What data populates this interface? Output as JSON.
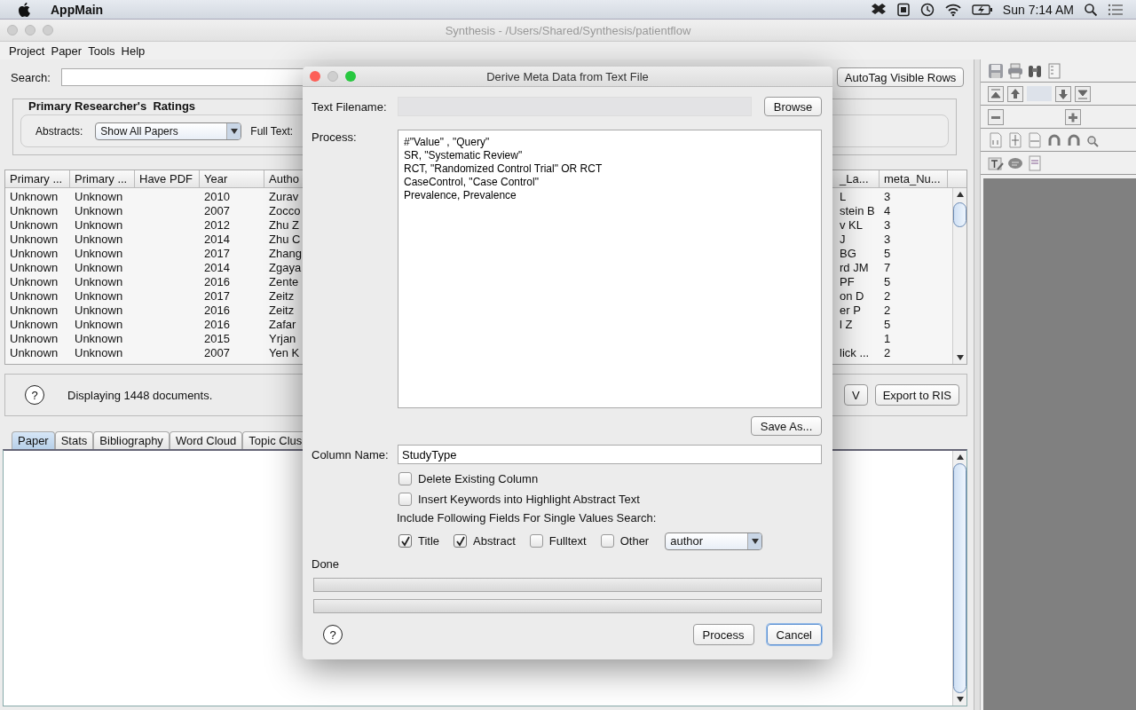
{
  "menubar": {
    "app_name": "AppMain",
    "clock": "Sun 7:14 AM"
  },
  "window": {
    "title": "Synthesis - /Users/Shared/Synthesis/patientflow"
  },
  "menu": [
    "Project",
    "Paper",
    "Tools",
    "Help"
  ],
  "search": {
    "label": "Search:"
  },
  "autotag_button": "AutoTag Visible Rows",
  "ratings": {
    "title": "Primary Researcher's  Ratings",
    "abstracts_label": "Abstracts:",
    "abstracts_value": "Show All Papers",
    "fulltext_label": "Full Text:"
  },
  "table": {
    "left_columns": [
      "Primary ...",
      "Primary ...",
      "Have PDF",
      "Year",
      "Autho"
    ],
    "right_columns": [
      "_La...",
      "meta_Nu..."
    ],
    "rows": [
      {
        "primary_1": "Unknown",
        "primary_2": "Unknown",
        "year": "2010",
        "author": "Zurav",
        "column_la": "L",
        "meta_nu": "3"
      },
      {
        "primary_1": "Unknown",
        "primary_2": "Unknown",
        "year": "2007",
        "author": "Zocco",
        "column_la": "stein B",
        "meta_nu": "4"
      },
      {
        "primary_1": "Unknown",
        "primary_2": "Unknown",
        "year": "2012",
        "author": "Zhu Z",
        "column_la": "v KL",
        "meta_nu": "3"
      },
      {
        "primary_1": "Unknown",
        "primary_2": "Unknown",
        "year": "2014",
        "author": "Zhu C",
        "column_la": "J",
        "meta_nu": "3"
      },
      {
        "primary_1": "Unknown",
        "primary_2": "Unknown",
        "year": "2017",
        "author": "Zhang",
        "column_la": "BG",
        "meta_nu": "5"
      },
      {
        "primary_1": "Unknown",
        "primary_2": "Unknown",
        "year": "2014",
        "author": "Zgaya",
        "column_la": "rd JM",
        "meta_nu": "7"
      },
      {
        "primary_1": "Unknown",
        "primary_2": "Unknown",
        "year": "2016",
        "author": "Zente",
        "column_la": "PF",
        "meta_nu": "5"
      },
      {
        "primary_1": "Unknown",
        "primary_2": "Unknown",
        "year": "2017",
        "author": "Zeitz",
        "column_la": "on D",
        "meta_nu": "2"
      },
      {
        "primary_1": "Unknown",
        "primary_2": "Unknown",
        "year": "2016",
        "author": "Zeitz",
        "column_la": "er P",
        "meta_nu": "2"
      },
      {
        "primary_1": "Unknown",
        "primary_2": "Unknown",
        "year": "2016",
        "author": "Zafar",
        "column_la": "l Z",
        "meta_nu": "5"
      },
      {
        "primary_1": "Unknown",
        "primary_2": "Unknown",
        "year": "2015",
        "author": "Yrjan",
        "meta_nu": "1"
      },
      {
        "primary_1": "Unknown",
        "primary_2": "Unknown",
        "year": "2007",
        "author": "Yen K",
        "column_la": "lick ...",
        "meta_nu": "2"
      }
    ]
  },
  "status": {
    "help_symbol": "?",
    "message": "Displaying 1448 documents.",
    "buttons": [
      "V",
      "Export to RIS"
    ]
  },
  "tabs": [
    {
      "label": "Paper",
      "selected": true
    },
    {
      "label": "Stats",
      "selected": false
    },
    {
      "label": "Bibliography",
      "selected": false
    },
    {
      "label": "Word Cloud",
      "selected": false
    },
    {
      "label": "Topic Clus",
      "selected": false
    }
  ],
  "dialog": {
    "title": "Derive Meta Data from Text File",
    "filename_label": "Text Filename:",
    "browse_button": "Browse",
    "process_label": "Process:",
    "process_lines": [
      "#\"Value\" , \"Query\"",
      "SR, \"Systematic Review\"",
      "RCT, \"Randomized Control Trial\" OR RCT",
      "CaseControl, \"Case Control\"",
      "Prevalence, Prevalence"
    ],
    "save_button": "Save As...",
    "column_name_label": "Column Name:",
    "column_name": "StudyType",
    "options": [
      {
        "label": "Delete Existing Column",
        "checked": false
      },
      {
        "label": "Insert Keywords into Highlight Abstract Text",
        "checked": false
      }
    ],
    "fields_label": "Include Following Fields For Single Values Search:",
    "fields": [
      {
        "label": "Title",
        "checked": true
      },
      {
        "label": "Abstract",
        "checked": true
      },
      {
        "label": "Fulltext",
        "checked": false
      },
      {
        "label": "Other",
        "checked": false
      }
    ],
    "other_field": "author",
    "done_label": "Done",
    "progress": [
      {
        "level": 0
      },
      {
        "level": 0
      }
    ],
    "help_symbol": "?",
    "buttons": [
      {
        "label": "Process",
        "default": false
      },
      {
        "label": "Cancel",
        "default": true
      }
    ]
  }
}
